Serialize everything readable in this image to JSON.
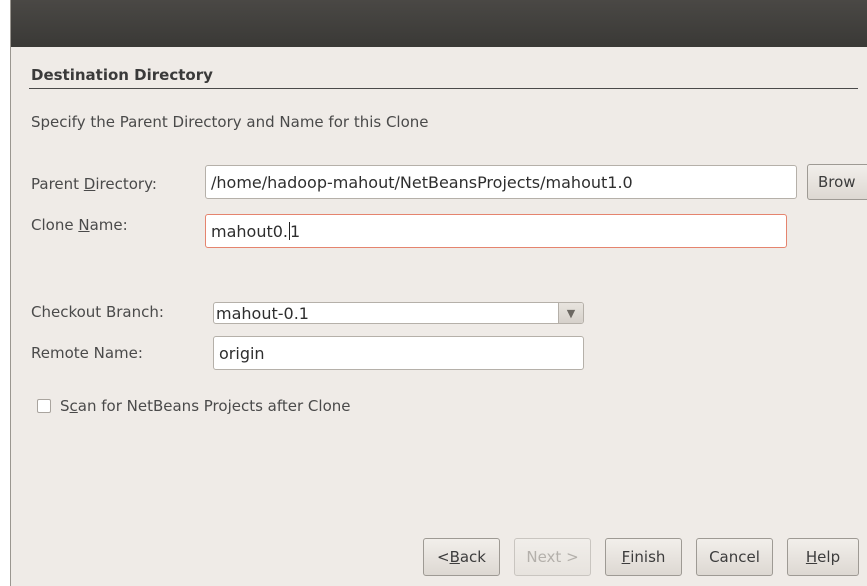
{
  "section": {
    "title": "Destination Directory",
    "subtitle": "Specify the Parent Directory and Name for this Clone"
  },
  "parent_directory": {
    "label_pre": "Parent ",
    "label_mnemonic": "D",
    "label_post": "irectory:",
    "value": "/home/hadoop-mahout/NetBeansProjects/mahout1.0",
    "browse_label": "Brow"
  },
  "clone_name": {
    "label_pre": "Clone ",
    "label_mnemonic": "N",
    "label_post": "ame:",
    "value_before_caret": "mahout0.",
    "value_after_caret": "1"
  },
  "checkout_branch": {
    "label": "Checkout Branch:",
    "value": "mahout-0.1",
    "arrow": "▼"
  },
  "remote_name": {
    "label": "Remote Name:",
    "value": "origin"
  },
  "scan_projects": {
    "label_pre": "S",
    "label_mnemonic": "c",
    "label_post": "an for NetBeans Projects after Clone",
    "checked": false
  },
  "buttons": {
    "back_pre": "< ",
    "back_mnemonic": "B",
    "back_post": "ack",
    "next": "Next >",
    "finish_mnemonic": "F",
    "finish_post": "inish",
    "cancel": "Cancel",
    "help_mnemonic": "H",
    "help_post": "elp"
  }
}
